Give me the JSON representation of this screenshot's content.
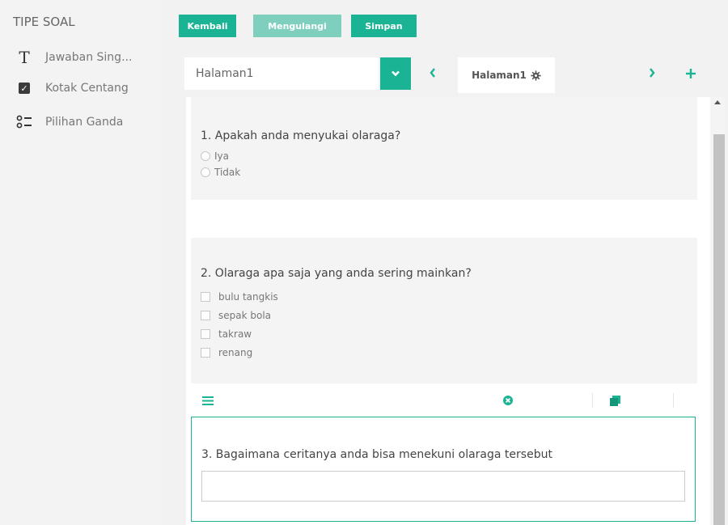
{
  "sidebar": {
    "title": "TIPE SOAL",
    "items": [
      {
        "label": "Jawaban Sing...",
        "icon": "text-icon",
        "glyph": "T"
      },
      {
        "label": "Kotak Centang",
        "icon": "checkbox-icon",
        "glyph": "✓"
      },
      {
        "label": "Pilihan Ganda",
        "icon": "radio-list-icon"
      }
    ]
  },
  "toolbar": {
    "back_label": "Kembali",
    "redo_label": "Mengulangi",
    "save_label": "Simpan"
  },
  "pages": {
    "selected": "Halaman1",
    "active_tab": "Halaman1"
  },
  "questions": [
    {
      "title": "1. Apakah anda menyukai olaraga?",
      "type": "radio",
      "options": [
        "Iya",
        "Tidak"
      ]
    },
    {
      "title": "2. Olaraga apa saja yang anda sering mainkan?",
      "type": "checkbox",
      "options": [
        "bulu tangkis",
        "sepak bola",
        "takraw",
        "renang"
      ]
    },
    {
      "title": "3. Bagaimana ceritanya anda bisa menekuni olaraga tersebut",
      "type": "text",
      "value": ""
    }
  ],
  "colors": {
    "accent": "#1ab394",
    "accent_disabled": "#7fcfbe",
    "background": "#f2f2f2",
    "card": "#f4f4f4"
  }
}
